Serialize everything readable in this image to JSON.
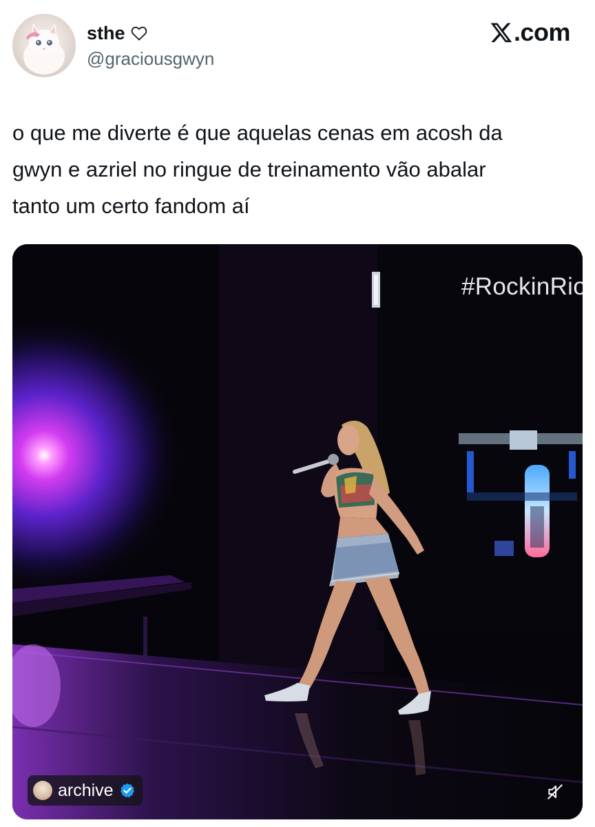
{
  "author": {
    "display_name": "sthe",
    "handle": "@graciousgwyn",
    "avatar_icon": "white-kitten-avatar",
    "name_badge_icon": "heart-outline-icon"
  },
  "brand": {
    "label": ".com",
    "icon": "x-logo-icon"
  },
  "tweet": {
    "text": "o que me diverte é que aquelas cenas em acosh da\ngwyn e azriel no ringue de treinamento vão abalar\ntanto um certo fandom aí"
  },
  "media": {
    "type": "video",
    "overlay_hashtag": "#RockinRio",
    "source_label": "archive",
    "source_verified_icon": "verified-badge-icon",
    "mute_icon": "speaker-muted-icon",
    "colors": {
      "stage_light": "#d83cff",
      "background": "#07050c",
      "verified": "#1d9bf0"
    }
  }
}
